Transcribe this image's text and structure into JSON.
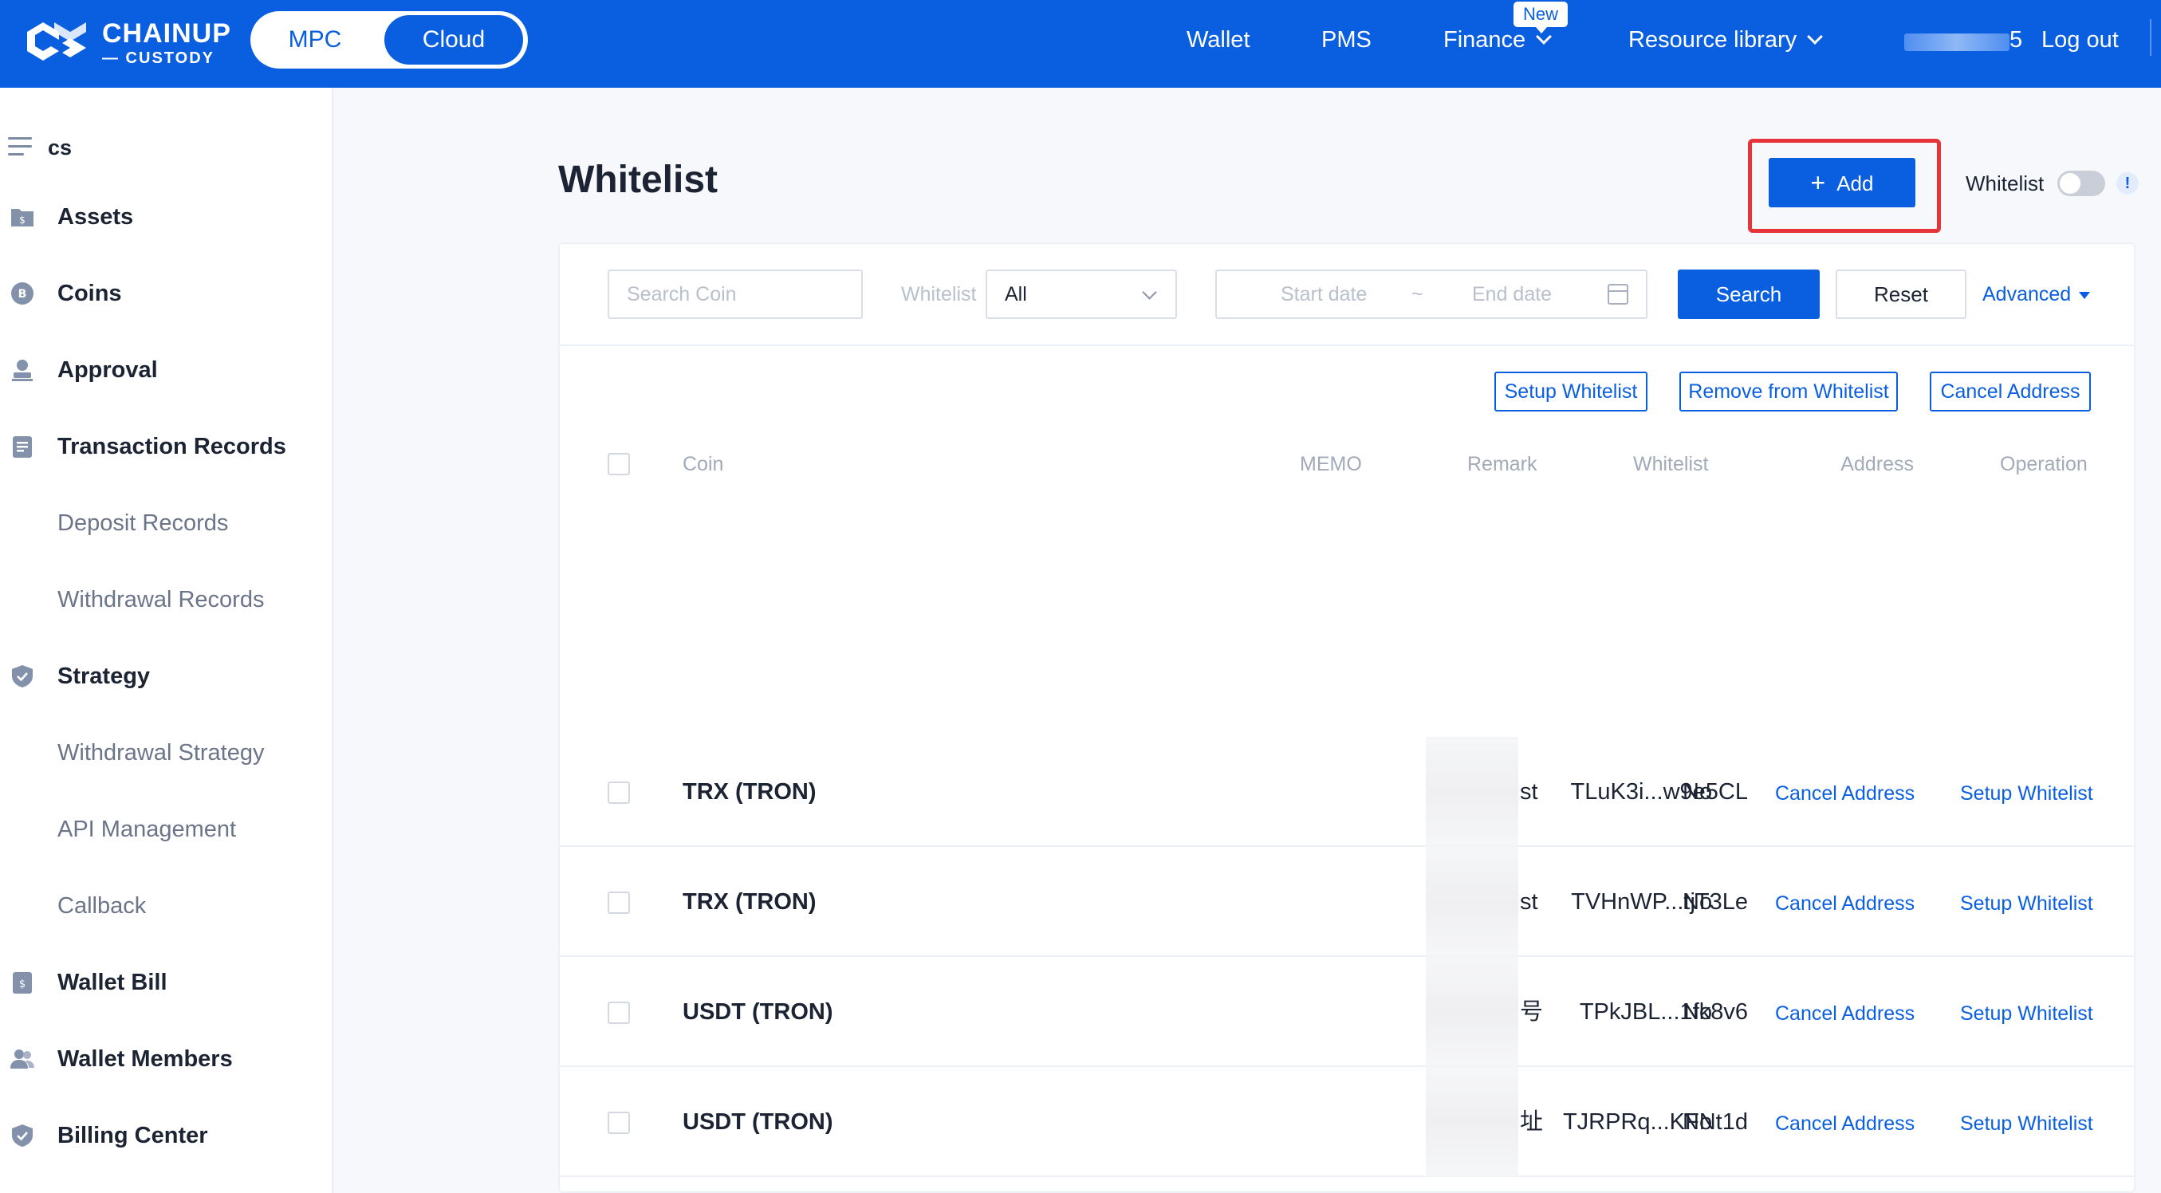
{
  "header": {
    "brand_name": "CHAINUP",
    "brand_sub": "— CUSTODY",
    "mode_toggle": {
      "options": [
        "MPC",
        "Cloud"
      ],
      "selected": "Cloud"
    },
    "nav": [
      {
        "label": "Wallet",
        "has_dropdown": false
      },
      {
        "label": "PMS",
        "has_dropdown": false
      },
      {
        "label": "Finance",
        "has_dropdown": true,
        "badge": "New"
      },
      {
        "label": "Resource library",
        "has_dropdown": true
      }
    ],
    "user_suffix": "5",
    "logout_label": "Log out"
  },
  "sidebar": {
    "workspace": "cs",
    "items": [
      {
        "label": "Assets",
        "icon": "folder-dollar-icon",
        "level": "top"
      },
      {
        "label": "Coins",
        "icon": "coin-icon",
        "level": "top"
      },
      {
        "label": "Approval",
        "icon": "user-stamp-icon",
        "level": "top"
      },
      {
        "label": "Transaction Records",
        "icon": "document-list-icon",
        "level": "top"
      },
      {
        "label": "Deposit Records",
        "level": "sub"
      },
      {
        "label": "Withdrawal Records",
        "level": "sub"
      },
      {
        "label": "Strategy",
        "icon": "shield-check-icon",
        "level": "top"
      },
      {
        "label": "Withdrawal Strategy",
        "level": "sub"
      },
      {
        "label": "API Management",
        "level": "sub"
      },
      {
        "label": "Callback",
        "level": "sub"
      },
      {
        "label": "Wallet Bill",
        "icon": "bill-icon",
        "level": "top"
      },
      {
        "label": "Wallet Members",
        "icon": "users-icon",
        "level": "top"
      },
      {
        "label": "Billing Center",
        "icon": "shield-check-icon",
        "level": "top"
      }
    ]
  },
  "page": {
    "title": "Whitelist",
    "add_label": "Add",
    "whitelist_toggle_label": "Whitelist",
    "whitelist_toggle_on": false,
    "info_glyph": "!"
  },
  "filters": {
    "search_placeholder": "Search Coin",
    "whitelist_label": "Whitelist",
    "whitelist_value": "All",
    "start_placeholder": "Start date",
    "range_sep": "~",
    "end_placeholder": "End date",
    "search_label": "Search",
    "reset_label": "Reset",
    "advanced_label": "Advanced"
  },
  "actions": {
    "setup_whitelist": "Setup Whitelist",
    "remove_whitelist": "Remove from Whitelist",
    "cancel_address": "Cancel Address"
  },
  "table": {
    "columns": {
      "coin": "Coin",
      "address": "Address",
      "memo": "MEMO",
      "remark": "Remark",
      "whitelist": "Whitelist",
      "operation": "Operation"
    },
    "rows": [
      {
        "coin": "TRX (TRON)",
        "address": "TLuK3i...w9e5CL",
        "memo": "",
        "remark": "st",
        "whitelist": "No",
        "op1": "Cancel Address",
        "op2": "Setup Whitelist"
      },
      {
        "coin": "TRX (TRON)",
        "address": "TVHnWP...tjT3Le",
        "memo": "",
        "remark": "st",
        "whitelist": "No",
        "op1": "Cancel Address",
        "op2": "Setup Whitelist"
      },
      {
        "coin": "USDT (TRON)",
        "address": "TPkJBL...1fk8v6",
        "memo": "",
        "remark": "号",
        "whitelist": "No",
        "op1": "Cancel Address",
        "op2": "Setup Whitelist"
      },
      {
        "coin": "USDT (TRON)",
        "address": "TJRPRq...KFNt1d",
        "memo": "",
        "remark": "址",
        "whitelist": "No",
        "op1": "Cancel Address",
        "op2": "Setup Whitelist"
      }
    ]
  },
  "colors": {
    "brand_blue": "#0a5fe0",
    "highlight_red": "#e5343a",
    "page_bg": "#f6f8fc"
  }
}
